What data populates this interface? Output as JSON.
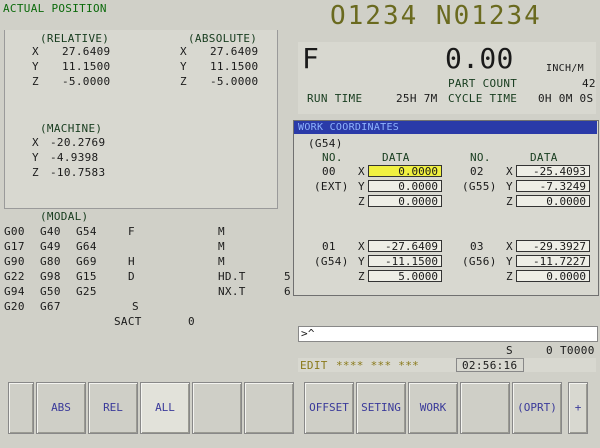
{
  "header": {
    "screen_title": "ACTUAL POSITION",
    "program_no": "O1234 N01234"
  },
  "relative": {
    "title": "(RELATIVE)",
    "axes": [
      {
        "axis": "X",
        "value": "27.6409"
      },
      {
        "axis": "Y",
        "value": "11.1500"
      },
      {
        "axis": "Z",
        "value": "-5.0000"
      }
    ]
  },
  "absolute": {
    "title": "(ABSOLUTE)",
    "axes": [
      {
        "axis": "X",
        "value": "27.6409"
      },
      {
        "axis": "Y",
        "value": "11.1500"
      },
      {
        "axis": "Z",
        "value": "-5.0000"
      }
    ]
  },
  "machine": {
    "title": "(MACHINE)",
    "axes": [
      {
        "axis": "X",
        "value": "-20.2769"
      },
      {
        "axis": "Y",
        "value": "-4.9398"
      },
      {
        "axis": "Z",
        "value": "-10.7583"
      }
    ]
  },
  "modal": {
    "title": "(MODAL)",
    "rows": [
      [
        "G00",
        "G40",
        "G54",
        "F",
        "",
        "M",
        ""
      ],
      [
        "G17",
        "G49",
        "G64",
        "",
        "",
        "M",
        ""
      ],
      [
        "G90",
        "G80",
        "G69",
        "H",
        "",
        "M",
        ""
      ],
      [
        "G22",
        "G98",
        "G15",
        "D",
        "",
        "HD.T",
        "5"
      ],
      [
        "G94",
        "G50",
        "G25",
        "",
        "",
        "NX.T",
        "6"
      ],
      [
        "G20",
        "G67",
        "",
        "",
        "S",
        "",
        ""
      ]
    ],
    "sact_label": "SACT",
    "sact_value": "0"
  },
  "feed": {
    "letter": "F",
    "value": "0.00",
    "unit": "INCH/M",
    "part_count_label": "PART COUNT",
    "part_count": "42",
    "run_time_label": "RUN TIME",
    "run_time": "25H 7M",
    "cycle_time_label": "CYCLE TIME",
    "cycle_time": "0H 0M 0S"
  },
  "work_coord": {
    "title": "WORK COORDINATES",
    "subtitle": "(G54)",
    "col_no": "NO.",
    "col_data": "DATA",
    "blocks": [
      {
        "no": "00",
        "name": "(EXT)",
        "x": "0.0000",
        "y": "0.0000",
        "z": "0.0000"
      },
      {
        "no": "02",
        "name": "(G55)",
        "x": "-25.4093",
        "y": "-7.3249",
        "z": "0.0000"
      },
      {
        "no": "01",
        "name": "(G54)",
        "x": "-27.6409",
        "y": "-11.1500",
        "z": "5.0000"
      },
      {
        "no": "03",
        "name": "(G56)",
        "x": "-29.3927",
        "y": "-11.7227",
        "z": "0.0000"
      }
    ]
  },
  "command": {
    "prompt": ">^"
  },
  "status": {
    "s_label": "S",
    "s_value": "0",
    "tool": "T0000",
    "mode": "EDIT",
    "stars": "**** *** ***",
    "clock": "02:56:16"
  },
  "softkeys": [
    "",
    "ABS",
    "REL",
    "ALL",
    "",
    "",
    "OFFSET",
    "SETING",
    "WORK",
    "",
    "(OPRT)",
    "+"
  ],
  "colors": {
    "selected_field": "#f0f040",
    "title_bar": "#2a3aa8",
    "screen_text": "#0b6a0b"
  }
}
